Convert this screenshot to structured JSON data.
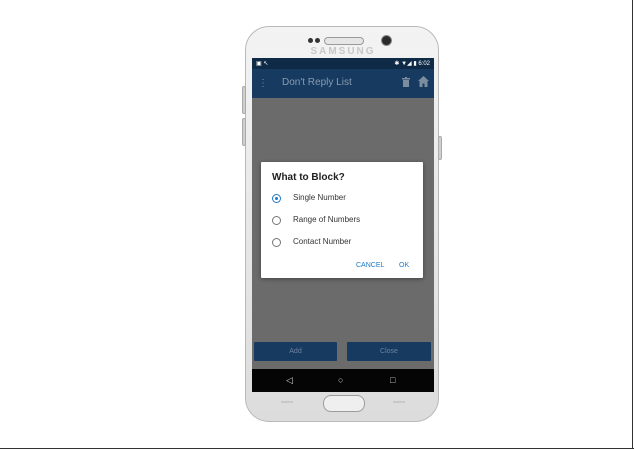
{
  "device": {
    "brand": "SAMSUNG"
  },
  "status_bar": {
    "time": "6:02",
    "left_icons": "▣ ↖",
    "right_icons": "✱ ▼◢ ▮"
  },
  "app_bar": {
    "title": "Don't Reply List",
    "menu_icon": "menu-icon",
    "actions": [
      "trash-icon",
      "home-icon"
    ]
  },
  "dialog": {
    "title": "What to Block?",
    "options": [
      {
        "label": "Single Number",
        "selected": true
      },
      {
        "label": "Range of Numbers",
        "selected": false
      },
      {
        "label": "Contact Number",
        "selected": false
      }
    ],
    "cancel_label": "CANCEL",
    "ok_label": "OK"
  },
  "bottom_buttons": {
    "add_label": "Add",
    "close_label": "Close"
  },
  "nav_bar": {
    "back": "◁",
    "home": "○",
    "recents": "□"
  },
  "colors": {
    "accent": "#1e78c8",
    "app_bar": "#163a60",
    "status_bar": "#0f2a46",
    "scrim": "#6b6b6b"
  }
}
